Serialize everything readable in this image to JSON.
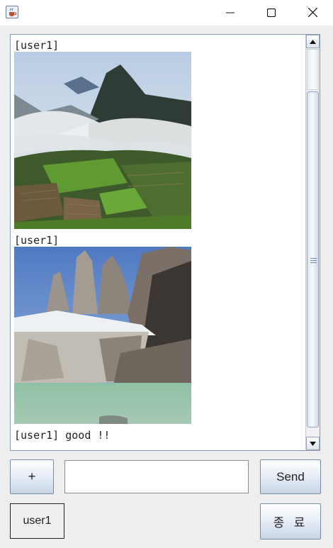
{
  "window": {
    "icon": "java-cup-icon",
    "controls": [
      "minimize-icon",
      "maximize-icon",
      "close-icon"
    ]
  },
  "chat": {
    "messages": [
      {
        "type": "image",
        "sender": "[user1]",
        "image": "machu-picchu-mountain-photo"
      },
      {
        "type": "image",
        "sender": "[user1]",
        "image": "torres-del-paine-lake-photo"
      },
      {
        "type": "text",
        "text": "[user1] good !!"
      }
    ]
  },
  "controls": {
    "add_label": "+",
    "input_value": "",
    "send_label": "Send",
    "user_name": "user1",
    "exit_label": "종 료"
  }
}
